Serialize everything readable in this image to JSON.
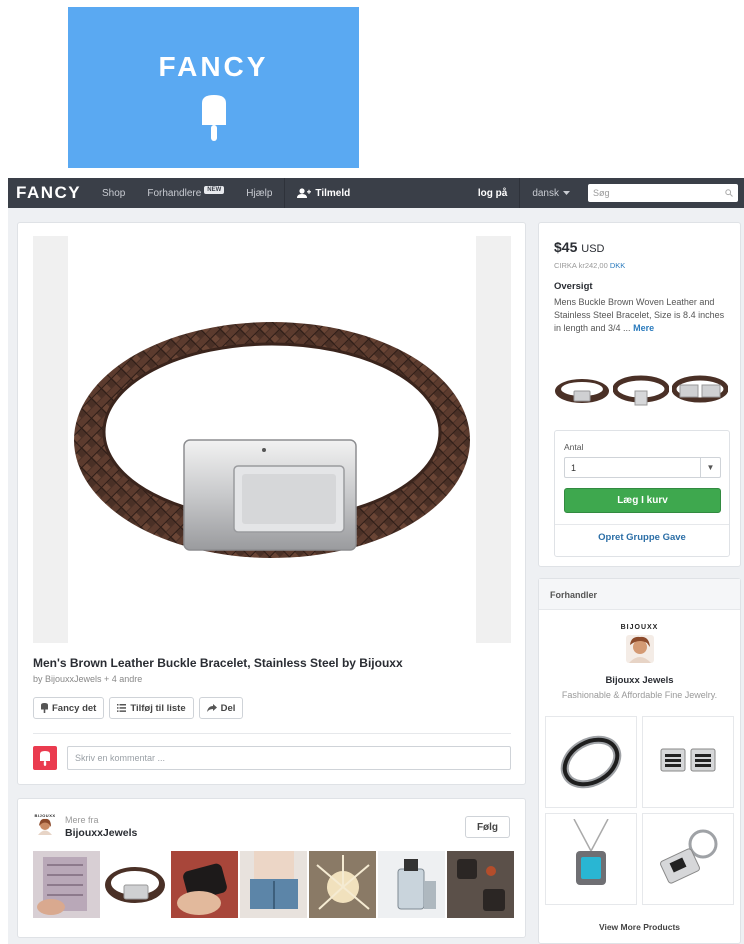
{
  "logo": {
    "word": "FANCY"
  },
  "nav": {
    "brand": "FANCY",
    "shop": "Shop",
    "retailers": "Forhandlere",
    "new_badge": "NEW",
    "help": "Hjælp",
    "join": "Tilmeld",
    "login": "log på",
    "language": "dansk",
    "search_placeholder": "Søg"
  },
  "product": {
    "title": "Men's Brown Leather Buckle Bracelet, Stainless Steel by Bijouxx",
    "by": "by BijouxxJewels + 4 andre",
    "buttons": {
      "fancy": "Fancy det",
      "add_list": "Tilføj til liste",
      "share": "Del"
    },
    "comment_placeholder": "Skriv en kommentar ..."
  },
  "more": {
    "logo_text": "BIJOUXX",
    "from": "Mere fra",
    "name": "BijouxxJewels",
    "follow": "Følg"
  },
  "price": {
    "amount": "$45",
    "currency": "USD",
    "approx": "CIRKA kr242,00",
    "approx_currency": "DKK",
    "overview_title": "Oversigt",
    "overview_text": "Mens Buckle Brown Woven Leather and Stainless Steel Bracelet, Size is 8.4 inches in length and 3/4 ...",
    "more_link": "Mere",
    "qty_label": "Antal",
    "qty_value": "1",
    "cart_button": "Læg I kurv",
    "gift_link": "Opret Gruppe Gave"
  },
  "retailer": {
    "header": "Forhandler",
    "logo_text": "BIJOUXX",
    "name": "Bijouxx Jewels",
    "tagline": "Fashionable & Affordable Fine Jewelry.",
    "view_more": "View More Products"
  },
  "colors": {
    "logo_bg": "#5aa9f2",
    "nav_bg": "#3a3f48",
    "cart_green": "#3ea84e",
    "link_blue": "#2b7bbd",
    "fancy_red": "#ea3b4f"
  }
}
